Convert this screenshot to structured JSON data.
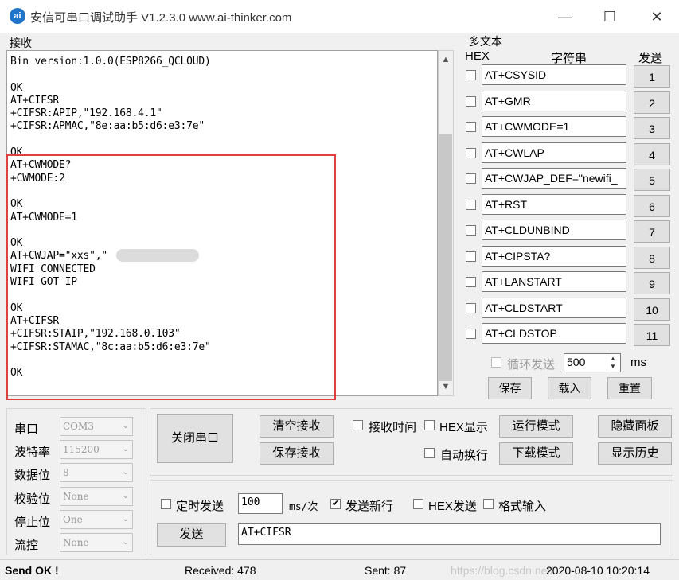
{
  "window": {
    "title": "安信可串口调试助手 V1.2.3.0    www.ai-thinker.com",
    "icon_text": "ai",
    "minimize": "—",
    "maximize": "☐",
    "close": "✕"
  },
  "receive": {
    "label": "接收",
    "lines": [
      "Bin version:1.0.0(ESP8266_QCLOUD)",
      "",
      "OK",
      "AT+CIFSR",
      "+CIFSR:APIP,\"192.168.4.1\"",
      "+CIFSR:APMAC,\"8e:aa:b5:d6:e3:7e\"",
      "",
      "OK",
      "AT+CWMODE?",
      "+CWMODE:2",
      "",
      "OK",
      "AT+CWMODE=1",
      "",
      "OK",
      "AT+CWJAP=\"xxs\",\"        \"",
      "WIFI CONNECTED",
      "WIFI GOT IP",
      "",
      "OK",
      "AT+CIFSR",
      "+CIFSR:STAIP,\"192.168.0.103\"",
      "+CIFSR:STAMAC,\"8c:aa:b5:d6:e3:7e\"",
      "",
      "OK"
    ]
  },
  "multi": {
    "label": "多文本",
    "hex_header": "HEX",
    "string_header": "字符串",
    "send_header": "发送",
    "rows": [
      {
        "cmd": "AT+CSYSID",
        "num": "1"
      },
      {
        "cmd": "AT+GMR",
        "num": "2"
      },
      {
        "cmd": "AT+CWMODE=1",
        "num": "3"
      },
      {
        "cmd": "AT+CWLAP",
        "num": "4"
      },
      {
        "cmd": "AT+CWJAP_DEF=\"newifi_",
        "num": "5"
      },
      {
        "cmd": "AT+RST",
        "num": "6"
      },
      {
        "cmd": "AT+CLDUNBIND",
        "num": "7"
      },
      {
        "cmd": "AT+CIPSTA?",
        "num": "8"
      },
      {
        "cmd": "AT+LANSTART",
        "num": "9"
      },
      {
        "cmd": "AT+CLDSTART",
        "num": "10"
      },
      {
        "cmd": "AT+CLDSTOP",
        "num": "11"
      }
    ],
    "loop_label": "循环发送",
    "loop_value": "500",
    "ms": "ms",
    "save": "保存",
    "load": "载入",
    "reset": "重置"
  },
  "port": {
    "fields": [
      {
        "label": "串口",
        "value": "COM3"
      },
      {
        "label": "波特率",
        "value": "115200"
      },
      {
        "label": "数据位",
        "value": "8"
      },
      {
        "label": "校验位",
        "value": "None"
      },
      {
        "label": "停止位",
        "value": "One"
      },
      {
        "label": "流控",
        "value": "None"
      }
    ],
    "close_port": "关闭串口",
    "clear_recv": "清空接收",
    "save_recv": "保存接收",
    "recv_time": "接收时间",
    "hex_show": "HEX显示",
    "auto_wrap": "自动换行",
    "run_mode": "运行模式",
    "download_mode": "下载模式",
    "hide_panel": "隐藏面板",
    "show_history": "显示历史"
  },
  "send": {
    "timed_send": "定时发送",
    "interval": "100",
    "unit": "ms/次",
    "send_newline": "发送新行",
    "hex_send": "HEX发送",
    "format_input": "格式输入",
    "send_button": "发送",
    "input_value": "AT+CIFSR"
  },
  "status": {
    "state": "Send OK !",
    "received": "Received: 478",
    "sent": "Sent: 87",
    "watermark": "https://blog.csdn.net/...",
    "datetime": "2020-08-10 10:20:14"
  }
}
